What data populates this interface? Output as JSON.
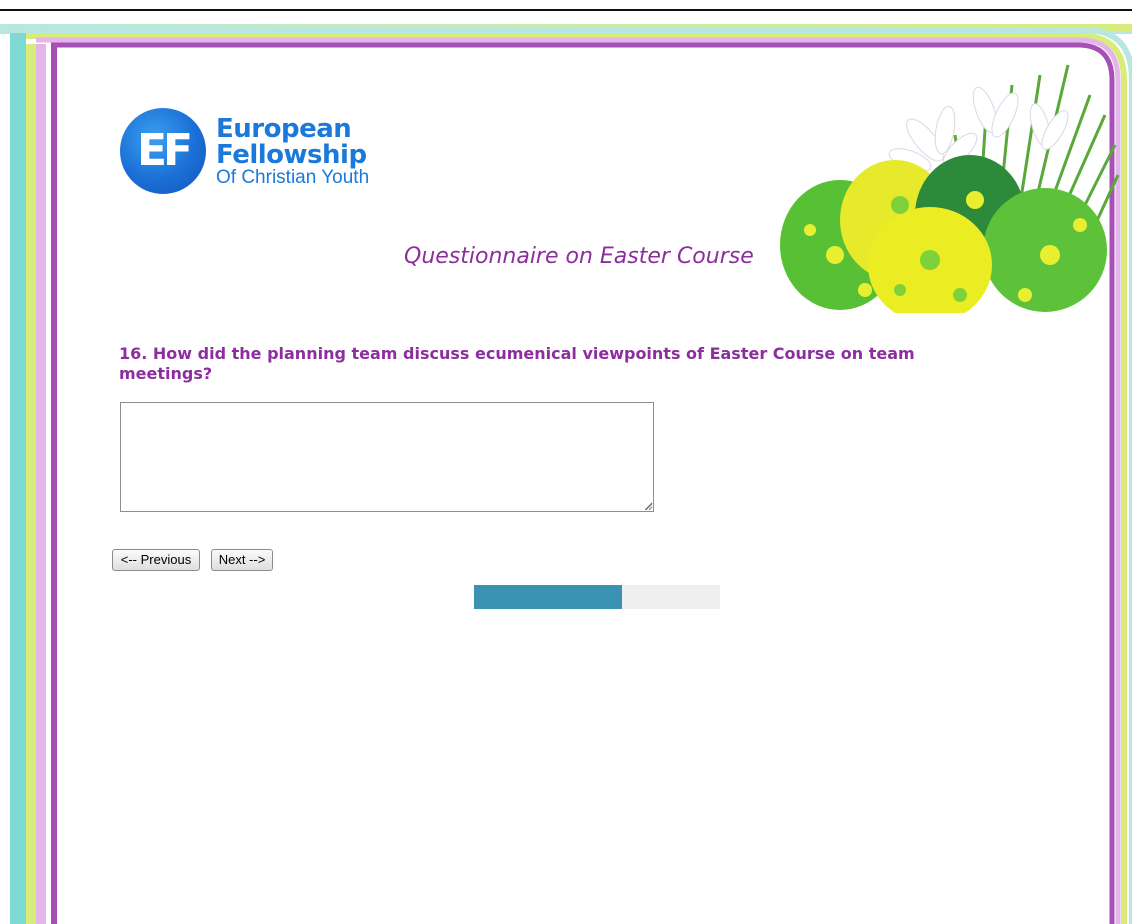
{
  "logo": {
    "mark": "EF",
    "line1": "European",
    "line2": "Fellowship",
    "line3": "Of Christian Youth"
  },
  "decoration": {
    "illustration": "easter-eggs-with-crocus-flowers",
    "colors": {
      "accent_purple": "#8c2e9e",
      "frame_purple": "#a64fb5",
      "stripe_teal": "#7fd9d3",
      "stripe_lime": "#d8ec7c",
      "stripe_pink": "#e3b5e8",
      "progress": "#3a93b3"
    }
  },
  "page": {
    "title": "Questionnaire on Easter Course"
  },
  "question": {
    "text": "16. How did the planning team discuss ecumenical viewpoints of Easter Course on team meetings?",
    "answer_value": ""
  },
  "navigation": {
    "previous_label": "<-- Previous",
    "next_label": "Next -->"
  },
  "progress": {
    "fraction": 0.6
  }
}
